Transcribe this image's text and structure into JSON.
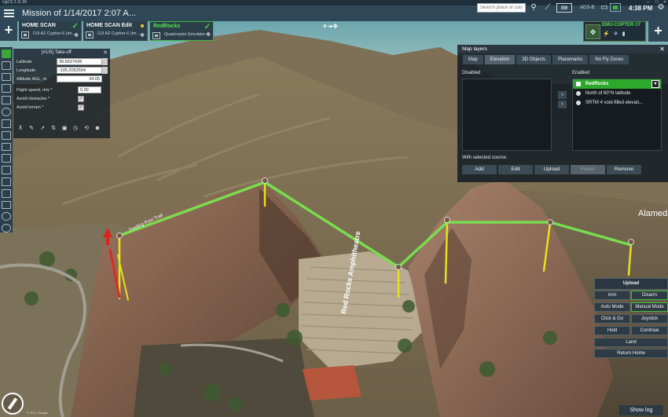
{
  "window": {
    "title": "UgCS 2.11.99",
    "controls": [
      "—",
      "☐",
      "✕"
    ]
  },
  "topbar": {
    "mission_title": "Mission of 1/14/2017 2:07 A...",
    "search_placeholder": "Search place or coordinates",
    "ads_b_label": "ADS-B",
    "time": "4:38 PM"
  },
  "missions": [
    {
      "name": "HOME SCAN",
      "subtitle": "DJI A2 Cypher-6 (im...",
      "status": "check"
    },
    {
      "name": "HOME SCAN Edit",
      "subtitle": "DJI A2 Cypher-6 (im...",
      "status": "pending"
    },
    {
      "name": "RedRocks",
      "subtitle": "Quadcopter Emulator",
      "status": "check"
    }
  ],
  "vehicle": {
    "name": "EMU-COPTER-17",
    "stats": [
      "⚡",
      "✈",
      "▮"
    ]
  },
  "waypoint": {
    "header": "[#1/5] Take-off",
    "close": "✕",
    "latitude_label": "Latitude",
    "latitude_value": "39.6637428",
    "longitude_label": "Longitude",
    "longitude_value": "-105.2052554",
    "altitude_label": "Altitude AGL, m",
    "altitude_value": "34.05",
    "speed_label": "Flight speed, m/s *",
    "speed_value": "5.00",
    "avoid_obstacles_label": "Avoid obstacles *",
    "avoid_terrain_label": "Avoid terrain *",
    "check_mark": "✓"
  },
  "layers": {
    "title": "Map layers",
    "close": "✕",
    "tabs": [
      "Map",
      "Elevation",
      "3D Objects",
      "Placemarks",
      "No Fly Zones"
    ],
    "selected_tab": "Elevation",
    "disabled_title": "Disabled",
    "enabled_title": "Enabled",
    "enabled_items": [
      {
        "label": "RedRocks",
        "selected": true
      },
      {
        "label": "North of 60°N latitude",
        "selected": false
      },
      {
        "label": "SRTM 4 void-filled elevati...",
        "selected": false
      }
    ],
    "dropdown_glyph": "▾",
    "move_right": "›",
    "move_left": "‹",
    "with_selected": "With selected source:",
    "actions": [
      "Add",
      "Edit",
      "Upload",
      "Focus",
      "Remove"
    ]
  },
  "commands": {
    "upload": "Upload",
    "arm": "Arm",
    "disarm": "Disarm",
    "auto_mode": "Auto Mode",
    "manual_mode": "Manual Mode",
    "click_go": "Click & Go",
    "joystick": "Joystick",
    "hold": "Hold",
    "continue": "Continue",
    "land": "Land",
    "return_home": "Return Home"
  },
  "map": {
    "amphitheatre_label": "Red Rocks Amphitheatre",
    "road_label": "Alameda",
    "trail_label": "Trading Post Trail"
  },
  "footer": {
    "show_log": "Show log",
    "copyright": "© 2017 Google"
  },
  "colors": {
    "accent_green": "#3ddc3d",
    "route_green": "#7de35a",
    "topbar": "#2f4757"
  }
}
